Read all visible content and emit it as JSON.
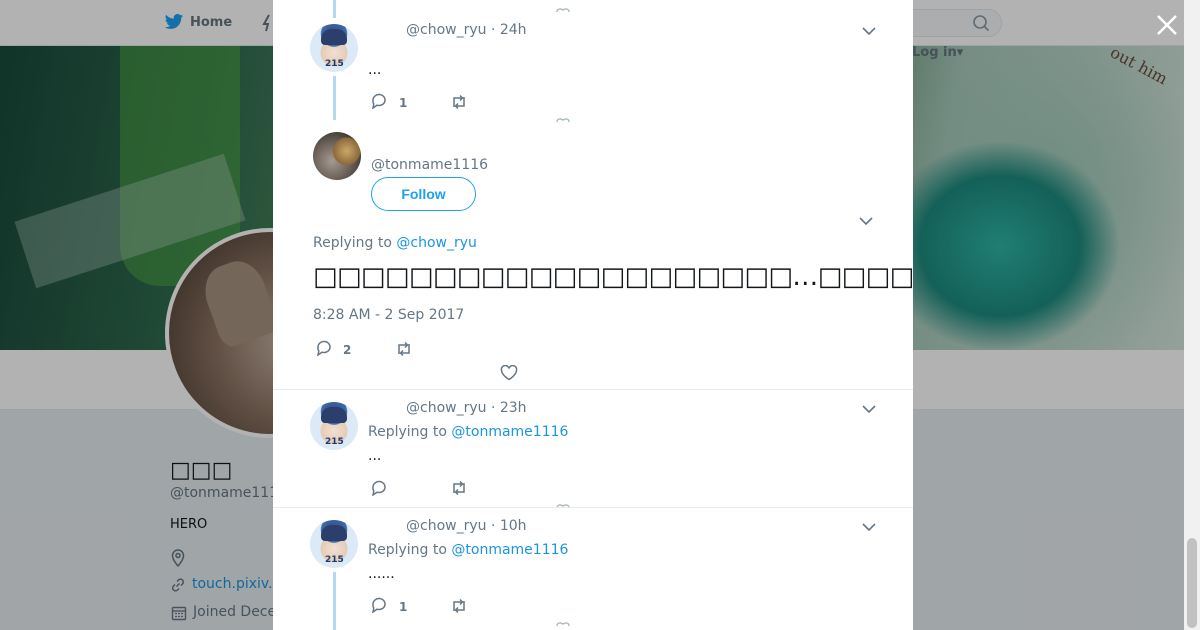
{
  "topbar": {
    "home_label": "Home",
    "login_label": "Log in▾"
  },
  "banner": {
    "partial_text": "out him"
  },
  "profile": {
    "name": "□□□",
    "handle": "@tonmame111",
    "bio": "HERO",
    "link": "touch.pixiv.",
    "joined": "Joined Dece"
  },
  "modal": {
    "tweet1": {
      "handle_time": "@chow_ryu · 24h",
      "text": "...",
      "reply_count": "1"
    },
    "focus": {
      "handle": "@tonmame1116",
      "follow_label": "Follow",
      "replying_prefix": "Replying to ",
      "replying_to": "@chow_ryu",
      "text": "□□□□□□□□□□□□□□□□□□□□…□□□□□□□□□□□□□□□□□□□□□□□□□□□□□□□□□□□□□□□",
      "timestamp": "8:28 AM - 2 Sep 2017",
      "reply_count": "2"
    },
    "tweet3": {
      "handle_time": "@chow_ryu · 23h",
      "replying_prefix": "Replying to ",
      "replying_to": "@tonmame1116",
      "text": "...",
      "reply_count": ""
    },
    "tweet4": {
      "handle_time": "@chow_ryu · 10h",
      "replying_prefix": "Replying to ",
      "replying_to": "@tonmame1116",
      "text": "......",
      "reply_count": "1"
    }
  },
  "colors": {
    "accent": "#1da1f2",
    "link": "#1b95e0",
    "muted": "#657786",
    "thread": "#b5d8f2"
  },
  "icons": [
    "twitter-bird-icon",
    "search-icon",
    "close-icon",
    "reply-icon",
    "retweet-icon",
    "like-icon",
    "chevron-down-icon",
    "location-icon",
    "link-icon",
    "calendar-icon"
  ]
}
